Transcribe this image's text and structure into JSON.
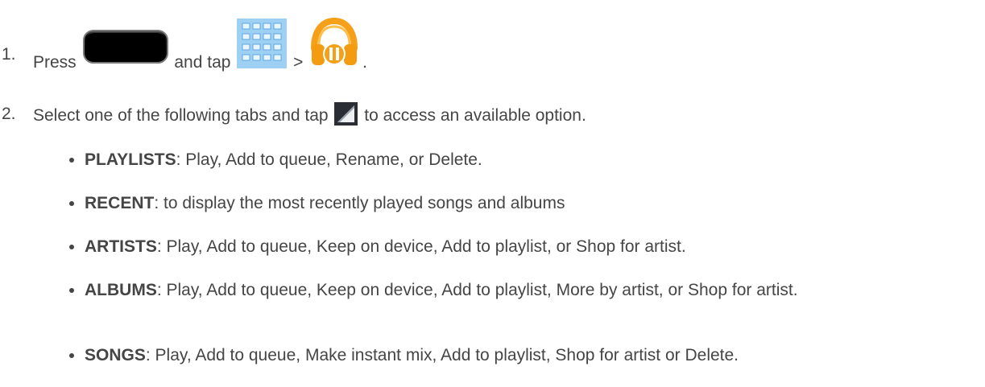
{
  "steps": [
    {
      "number": "1.",
      "parts": {
        "before_home": "Press",
        "home_icon": "home-key-icon",
        "between": "and tap",
        "apps_icon": "apps-grid-icon",
        "separator": ">",
        "music_icon": "play-music-headphones-icon",
        "end": "."
      }
    },
    {
      "number": "2.",
      "parts": {
        "before_icon": "Select one of the following tabs and tap",
        "menu_icon": "menu-corner-icon",
        "after_icon": "to access an available option."
      }
    }
  ],
  "tabs": [
    {
      "name": "PLAYLISTS",
      "desc": ": Play, Add to queue, Rename, or Delete."
    },
    {
      "name": "RECENT",
      "desc": ": to display the most recently played songs and albums"
    },
    {
      "name": "ARTISTS",
      "desc": ": Play, Add to queue, Keep on device, Add to playlist, or Shop for artist."
    },
    {
      "name": "ALBUMS",
      "desc": ": Play, Add to queue, Keep on device, Add to playlist, More by artist, or Shop for artist."
    },
    {
      "name": "SONGS",
      "desc": ": Play, Add to queue, Make instant mix, Add to playlist, Shop for artist or Delete."
    }
  ],
  "colors": {
    "text": "#454545",
    "music_orange": "#f6a01a",
    "apps_blue": "#6fb6ee"
  }
}
